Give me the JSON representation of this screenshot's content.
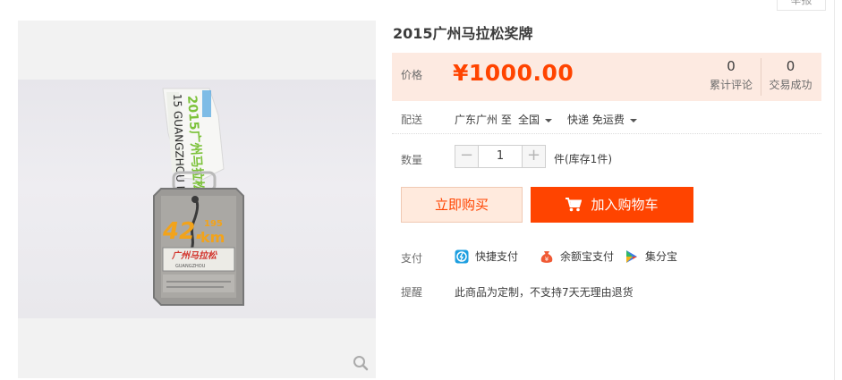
{
  "report": {
    "label": "举报"
  },
  "product": {
    "title": "2015广州马拉松奖牌",
    "price_label": "价格",
    "price": "¥1000.00",
    "reviews": {
      "count": "0",
      "label": "累计评论"
    },
    "trades": {
      "count": "0",
      "label": "交易成功"
    }
  },
  "shipping": {
    "label": "配送",
    "from": "广东广州 至",
    "to": "全国",
    "method": "快递 免运费"
  },
  "quantity": {
    "label": "数量",
    "value": "1",
    "minus": "−",
    "plus": "+",
    "stock": "件(库存1件)"
  },
  "actions": {
    "buy_now": "立即购买",
    "add_to_cart": "加入购物车"
  },
  "payment": {
    "label": "支付",
    "methods": [
      "快捷支付",
      "余额宝支付",
      "集分宝"
    ]
  },
  "notice": {
    "label": "提醒",
    "text": "此商品为定制，不支持7天无理由退货"
  },
  "colors": {
    "accent": "#ff4400",
    "price_bg": "#fdeae1",
    "buy_bg": "#ffeadd"
  }
}
